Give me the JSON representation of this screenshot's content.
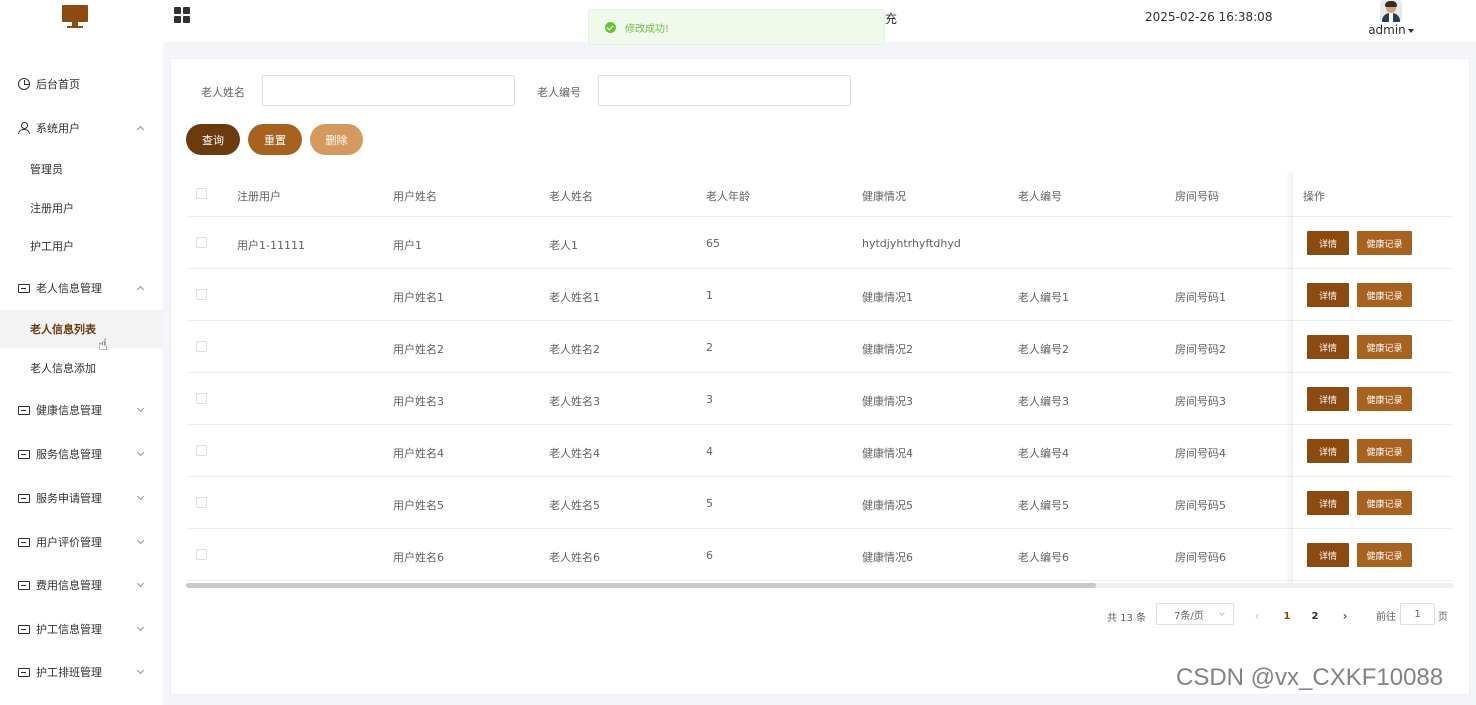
{
  "header": {
    "logo_icon": "monitor-icon",
    "menu_icon": "grid-icon",
    "title_fragment": "充",
    "datetime": "2025-02-26 16:38:08",
    "username": "admin"
  },
  "toast": {
    "type": "success",
    "message": "修改成功!"
  },
  "sidebar": {
    "home": "后台首页",
    "system_users": {
      "label": "系统用户",
      "children": [
        "管理员",
        "注册用户",
        "护工用户"
      ]
    },
    "elder_info": {
      "label": "老人信息管理",
      "children": [
        "老人信息列表",
        "老人信息添加"
      ],
      "active": "老人信息列表"
    },
    "groups": [
      "健康信息管理",
      "服务信息管理",
      "服务申请管理",
      "用户评价管理",
      "费用信息管理",
      "护工信息管理",
      "护工排班管理"
    ]
  },
  "search": {
    "elder_name_label": "老人姓名",
    "elder_name_value": "",
    "elder_no_label": "老人编号",
    "elder_no_value": ""
  },
  "actions": {
    "query": "查询",
    "reset": "重置",
    "delete": "删除"
  },
  "table": {
    "columns": [
      "注册用户",
      "用户姓名",
      "老人姓名",
      "老人年龄",
      "健康情况",
      "老人编号",
      "房间号码",
      "操作"
    ],
    "rows": [
      {
        "reg_user": "用户1-11111",
        "user_name": "用户1",
        "elder_name": "老人1",
        "age": "65",
        "health": "hytdjyhtrhyftdhyd",
        "elder_no": "",
        "room": ""
      },
      {
        "reg_user": "",
        "user_name": "用户姓名1",
        "elder_name": "老人姓名1",
        "age": "1",
        "health": "健康情况1",
        "elder_no": "老人编号1",
        "room": "房间号码1"
      },
      {
        "reg_user": "",
        "user_name": "用户姓名2",
        "elder_name": "老人姓名2",
        "age": "2",
        "health": "健康情况2",
        "elder_no": "老人编号2",
        "room": "房间号码2"
      },
      {
        "reg_user": "",
        "user_name": "用户姓名3",
        "elder_name": "老人姓名3",
        "age": "3",
        "health": "健康情况3",
        "elder_no": "老人编号3",
        "room": "房间号码3"
      },
      {
        "reg_user": "",
        "user_name": "用户姓名4",
        "elder_name": "老人姓名4",
        "age": "4",
        "health": "健康情况4",
        "elder_no": "老人编号4",
        "room": "房间号码4"
      },
      {
        "reg_user": "",
        "user_name": "用户姓名5",
        "elder_name": "老人姓名5",
        "age": "5",
        "health": "健康情况5",
        "elder_no": "老人编号5",
        "room": "房间号码5"
      },
      {
        "reg_user": "",
        "user_name": "用户姓名6",
        "elder_name": "老人姓名6",
        "age": "6",
        "health": "健康情况6",
        "elder_no": "老人编号6",
        "room": "房间号码6"
      }
    ],
    "row_actions": {
      "detail": "详情",
      "health_record": "健康记录"
    }
  },
  "pagination": {
    "total": "共 13 条",
    "page_size": "7条/页",
    "pages": [
      "1",
      "2"
    ],
    "current_page": "1",
    "goto_label": "前往",
    "goto_value": "1",
    "page_suffix": "页"
  },
  "watermark": "CSDN @vx_CXKF10088",
  "colors": {
    "brand_dark": "#6b3a0d",
    "brand": "#8b4a10",
    "brand_mid": "#a7621f",
    "brand_light": "#d49a5d",
    "success": "#67c23a"
  }
}
